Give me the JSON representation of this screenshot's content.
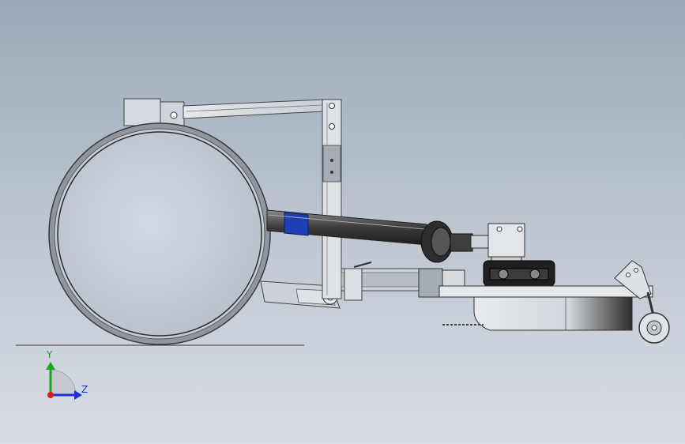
{
  "viewport": {
    "triad": {
      "y_label": "Y",
      "z_label": "Z",
      "colors": {
        "y": "#1fa51f",
        "z": "#1f2fd6",
        "x_origin": "#d81c1c"
      }
    }
  }
}
